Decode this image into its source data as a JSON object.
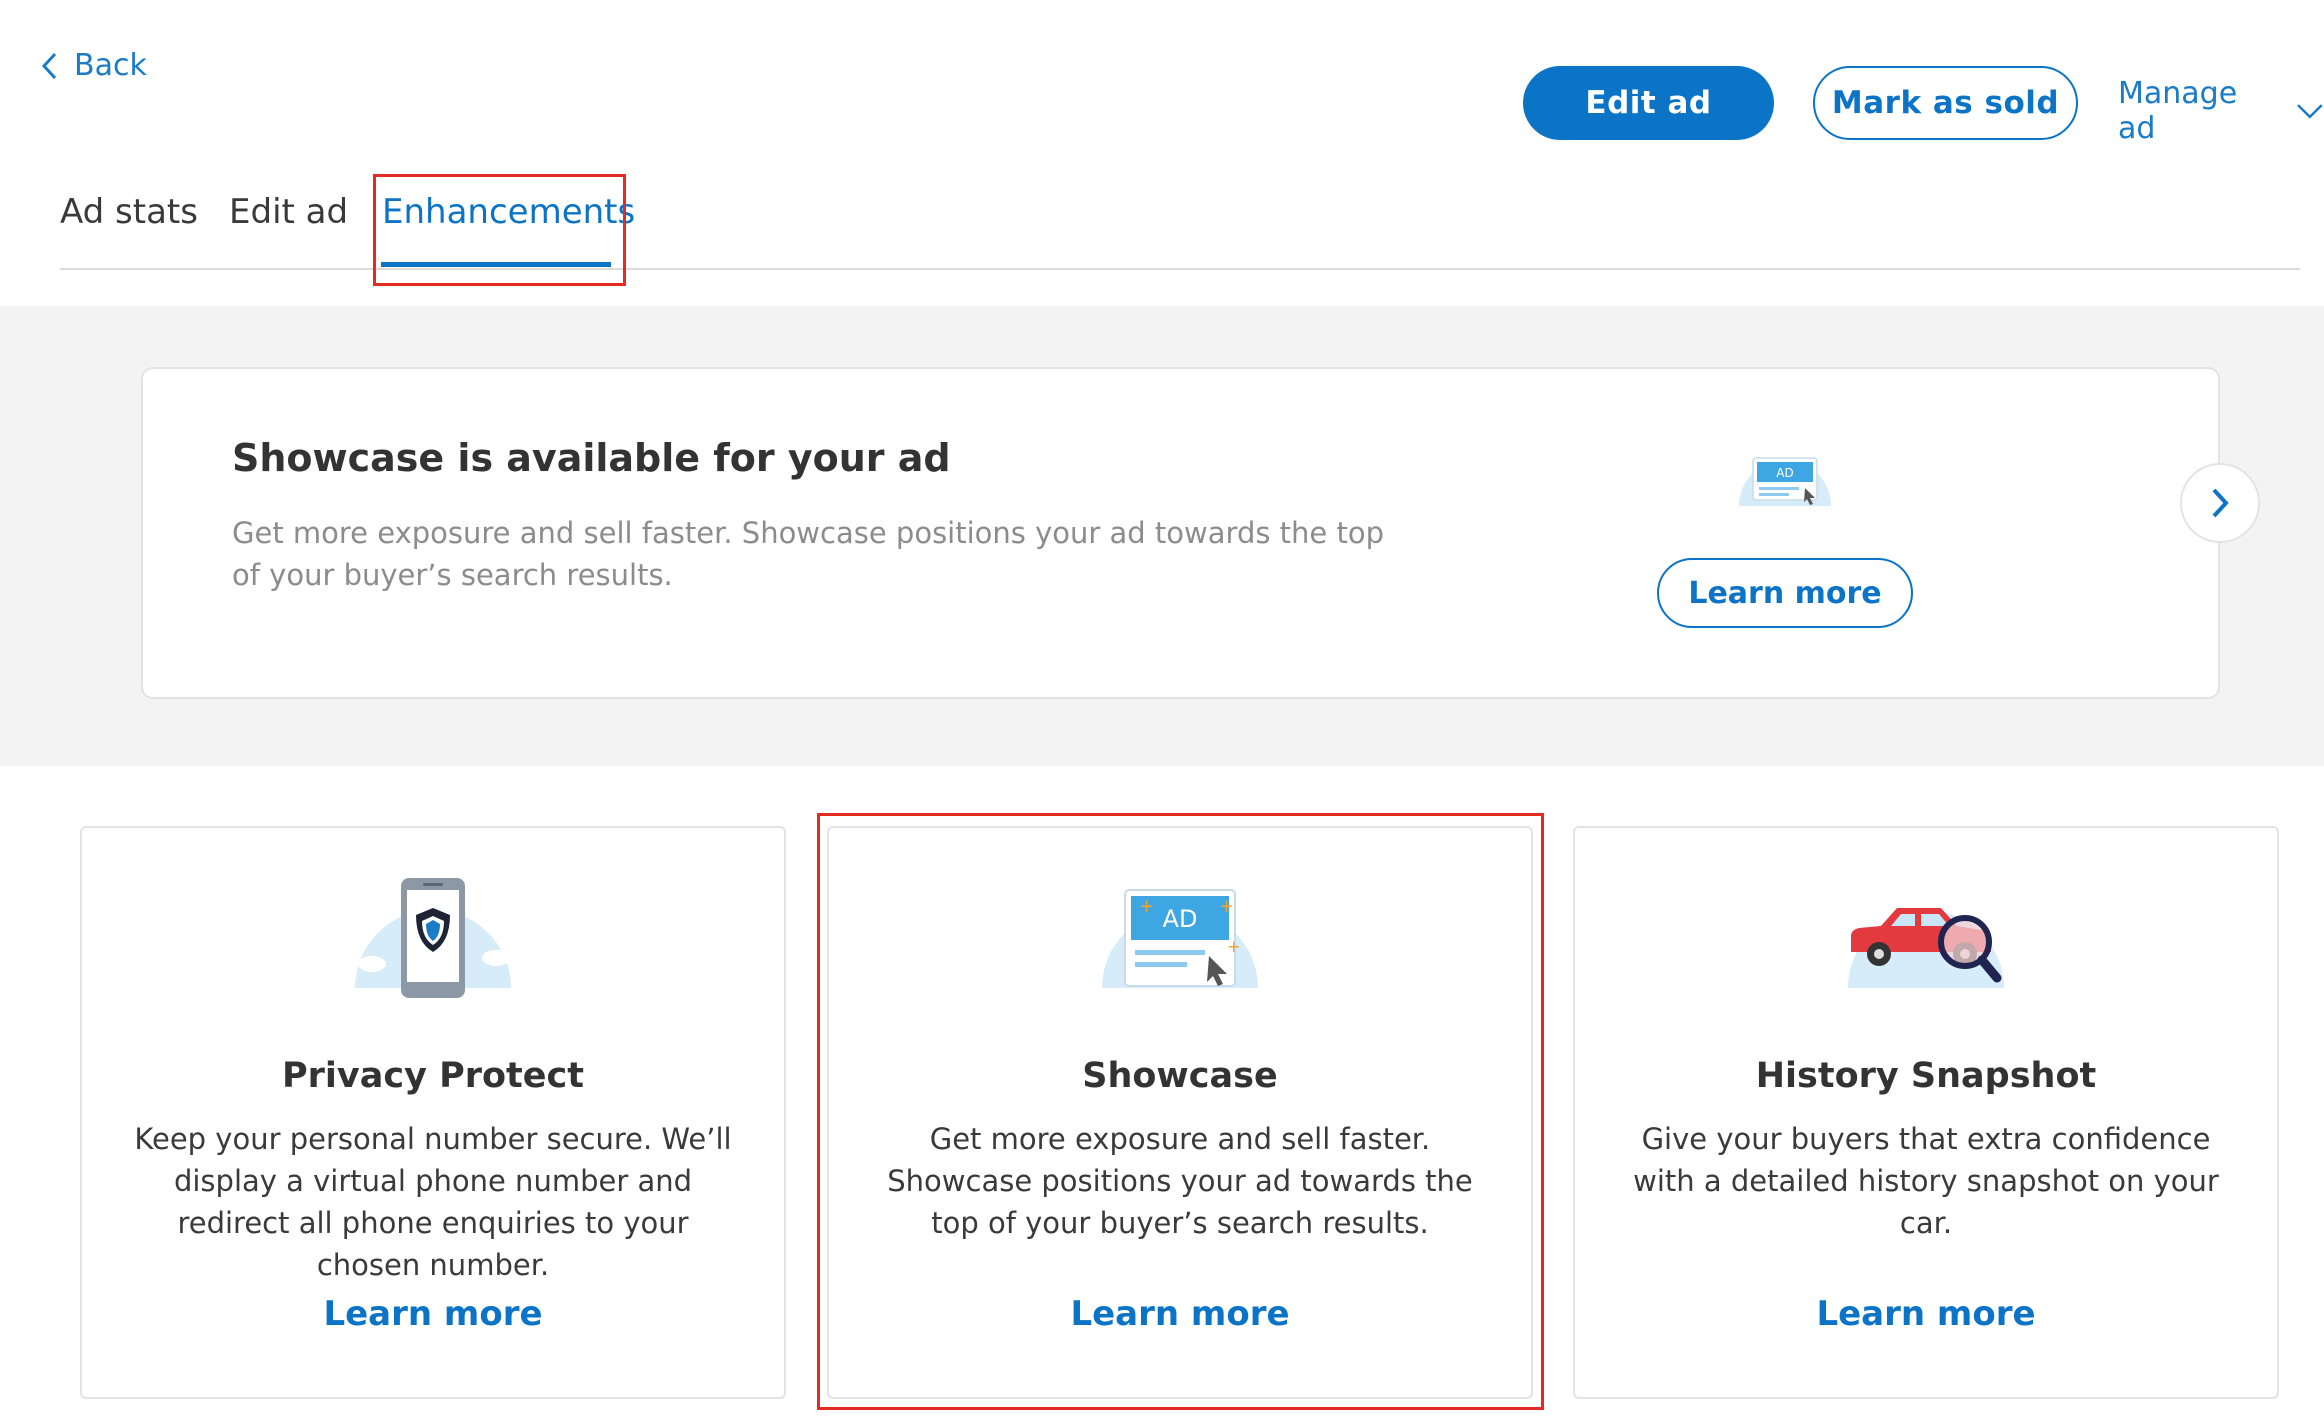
{
  "header": {
    "back_label": "Back",
    "edit_ad_label": "Edit ad",
    "mark_sold_label": "Mark as sold",
    "manage_ad_label": "Manage ad"
  },
  "tabs": [
    {
      "label": "Ad stats",
      "active": false
    },
    {
      "label": "Edit ad",
      "active": false
    },
    {
      "label": "Enhancements",
      "active": true
    }
  ],
  "banner": {
    "title": "Showcase is available for your ad",
    "description": "Get more exposure and sell faster. Showcase positions your ad towards the top of your buyer’s search results.",
    "button_label": "Learn more",
    "icon": "showcase-ad-icon",
    "badge": "AD"
  },
  "cards": [
    {
      "title": "Privacy Protect",
      "description": "Keep your personal number secure. We’ll display a virtual phone number and redirect all phone enquiries to your chosen number.",
      "link_label": "Learn more",
      "icon": "privacy-protect-icon"
    },
    {
      "title": "Showcase",
      "description": "Get more exposure and sell faster. Showcase positions your ad towards the top of your buyer’s search results.",
      "link_label": "Learn more",
      "icon": "showcase-ad-icon",
      "badge": "AD"
    },
    {
      "title": "History Snapshot",
      "description": "Give your buyers that extra confidence with a detailed history snapshot on your car.",
      "link_label": "Learn more",
      "icon": "history-snapshot-icon"
    }
  ],
  "colors": {
    "brand_blue": "#0c74c6",
    "highlight_red": "#e32b21",
    "band_grey": "#f3f3f3"
  }
}
